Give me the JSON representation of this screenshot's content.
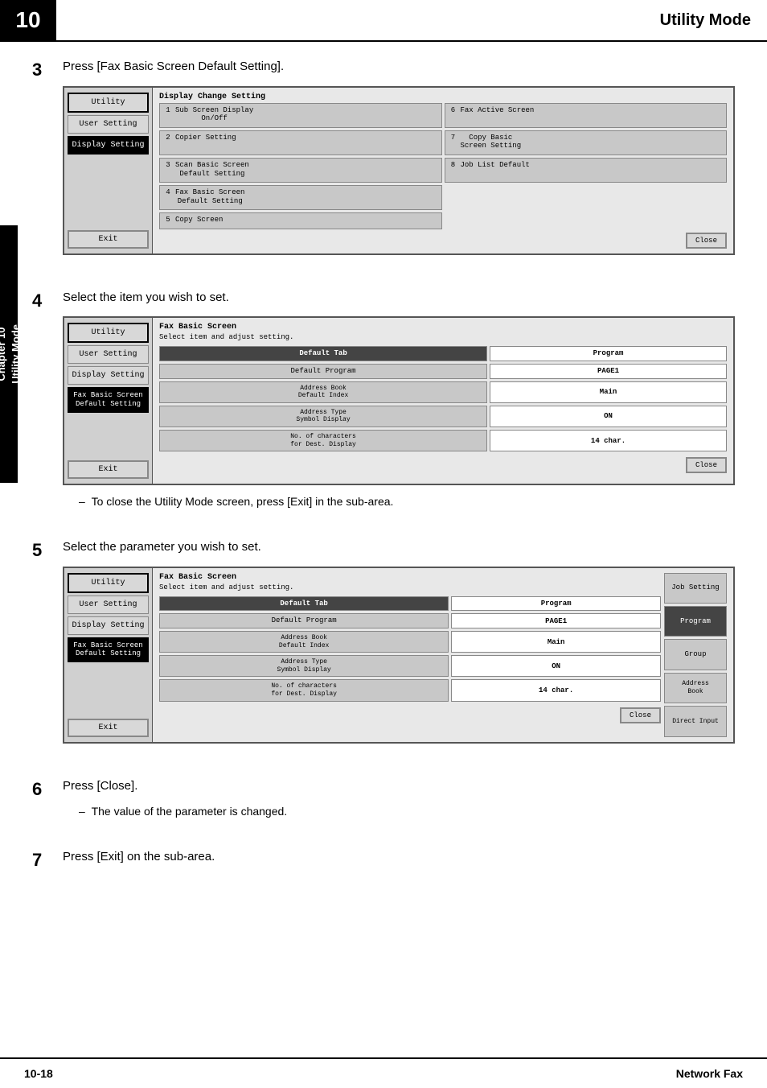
{
  "header": {
    "chapter_num": "10",
    "title": "Utility Mode"
  },
  "sidebar_tab": {
    "line1": "Chapter 10",
    "line2": "Utility Mode"
  },
  "footer": {
    "left": "10-18",
    "right": "Network Fax"
  },
  "steps": [
    {
      "num": "3",
      "desc": "Press [Fax Basic Screen Default Setting].",
      "has_screen": true,
      "screen_type": "display_change"
    },
    {
      "num": "4",
      "desc": "Select the item you wish to set.",
      "has_screen": true,
      "screen_type": "fax_basic_1",
      "note": "To close the Utility Mode screen, press [Exit] in the sub-area."
    },
    {
      "num": "5",
      "desc": "Select the parameter you wish to set.",
      "has_screen": true,
      "screen_type": "fax_basic_2"
    },
    {
      "num": "6",
      "desc": "Press [Close].",
      "note": "The value of the parameter is changed."
    },
    {
      "num": "7",
      "desc": "Press [Exit] on the sub-area."
    }
  ],
  "screen1": {
    "sidebar": {
      "btn1": "Utility",
      "btn2": "User Setting",
      "btn3": "Display Setting",
      "exit": "Exit"
    },
    "title": "Display Change Setting",
    "items": [
      {
        "num": "1",
        "label": "Sub Screen Display\nOn/Off",
        "col": 1
      },
      {
        "num": "6",
        "label": "Fax Active Screen",
        "col": 2
      },
      {
        "num": "2",
        "label": "Copier Setting",
        "col": 1
      },
      {
        "num": "7",
        "label": "Copy Basic\nScreen Setting",
        "col": 2
      },
      {
        "num": "3",
        "label": "Scan Basic Screen\nDefault Setting",
        "col": 1
      },
      {
        "num": "8",
        "label": "Job List Default",
        "col": 2
      },
      {
        "num": "4",
        "label": "Fax Basic Screen\nDefault Setting",
        "col": 1
      },
      {
        "num": "5",
        "label": "Copy Screen",
        "col": 1
      }
    ],
    "close": "Close"
  },
  "screen2": {
    "sidebar": {
      "btn1": "Utility",
      "btn2": "User Setting",
      "btn3": "Display Setting",
      "btn4": "Fax Basic Screen\nDefault Setting",
      "exit": "Exit"
    },
    "title": "Fax Basic Screen",
    "subtitle": "Select item and adjust setting.",
    "rows": [
      {
        "label": "Default Tab",
        "value": "Program",
        "label_active": true
      },
      {
        "label": "Default Program",
        "value": "PAGE1"
      },
      {
        "label": "Address Book\nDefault Index",
        "value": "Main"
      },
      {
        "label": "Address Type\nSymbol Display",
        "value": "ON"
      },
      {
        "label": "No. of characters\nfor Dest. Display",
        "value": "14 char."
      }
    ],
    "close": "Close"
  },
  "screen3": {
    "sidebar": {
      "btn1": "Utility",
      "btn2": "User Setting",
      "btn3": "Display Setting",
      "btn4": "Fax Basic Screen\nDefault Setting",
      "exit": "Exit"
    },
    "title": "Fax Basic Screen",
    "subtitle": "Select item and adjust setting.",
    "rows": [
      {
        "label": "Default Tab",
        "value": "Program",
        "label_active": true
      },
      {
        "label": "Default Program",
        "value": "PAGE1"
      },
      {
        "label": "Address Book\nDefault Index",
        "value": "Main"
      },
      {
        "label": "Address Type\nSymbol Display",
        "value": "ON"
      },
      {
        "label": "No. of characters\nfor Dest. Display",
        "value": "14 char."
      }
    ],
    "right_col": {
      "header": "Job Setting",
      "items": [
        "Program",
        "Group",
        "Address\nBook",
        "Direct Input"
      ]
    },
    "close": "Close"
  }
}
